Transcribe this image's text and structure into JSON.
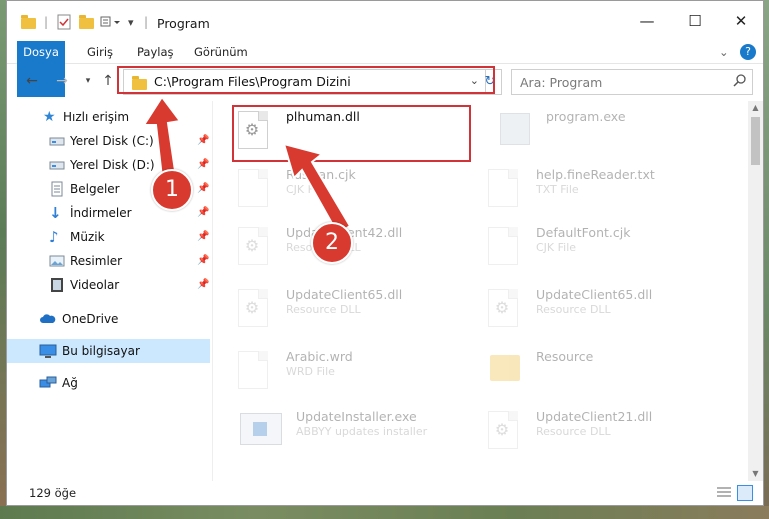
{
  "window": {
    "title": "Program",
    "controls": {
      "minimize": "—",
      "maximize": "☐",
      "close": "✕"
    }
  },
  "ribbon": {
    "tabs": [
      "Dosya",
      "Giriş",
      "Paylaş",
      "Görünüm"
    ],
    "help": "?"
  },
  "address": {
    "path": "C:\\Program Files\\Program Dizini",
    "search_placeholder": "Ara: Program"
  },
  "nav": {
    "items": [
      {
        "label": "Hızlı erişim",
        "icon": "star-icon"
      },
      {
        "label": "Yerel Disk (C:)",
        "icon": "drive-icon",
        "pinned": true
      },
      {
        "label": "Yerel Disk (D:)",
        "icon": "drive-icon",
        "pinned": true
      },
      {
        "label": "Belgeler",
        "icon": "documents-icon",
        "pinned": true
      },
      {
        "label": "İndirmeler",
        "icon": "download-icon",
        "pinned": true
      },
      {
        "label": "Müzik",
        "icon": "music-icon",
        "pinned": true
      },
      {
        "label": "Resimler",
        "icon": "pictures-icon",
        "pinned": true
      },
      {
        "label": "Videolar",
        "icon": "videos-icon",
        "pinned": true
      },
      {
        "label": "OneDrive",
        "icon": "cloud-icon"
      },
      {
        "label": "Bu bilgisayar",
        "icon": "computer-icon",
        "selected": true
      },
      {
        "label": "Ağ",
        "icon": "network-icon"
      }
    ]
  },
  "files": [
    {
      "name": "plhuman.dll",
      "type": ""
    },
    {
      "name": "program.exe",
      "type": ""
    },
    {
      "name": "Russian.cjk",
      "type": "CJK File"
    },
    {
      "name": "help.fineReader.txt",
      "type": "TXT File"
    },
    {
      "name": "UpdateClient42.dll",
      "type": "Resource DLL"
    },
    {
      "name": "DefaultFont.cjk",
      "type": "CJK File"
    },
    {
      "name": "UpdateClient65.dll",
      "type": "Resource DLL"
    },
    {
      "name": "UpdateClient65.dll",
      "type": "Resource DLL"
    },
    {
      "name": "Arabic.wrd",
      "type": "WRD File"
    },
    {
      "name": "Resource",
      "type": ""
    },
    {
      "name": "UpdateInstaller.exe",
      "type": "ABBYY updates installer"
    },
    {
      "name": "UpdateClient21.dll",
      "type": "Resource DLL"
    }
  ],
  "status": {
    "count": "129 öğe"
  },
  "annotations": {
    "marker1": "1",
    "marker2": "2"
  },
  "colors": {
    "accent": "#1979ca",
    "highlight": "#d13438",
    "selection": "#cce8ff"
  }
}
